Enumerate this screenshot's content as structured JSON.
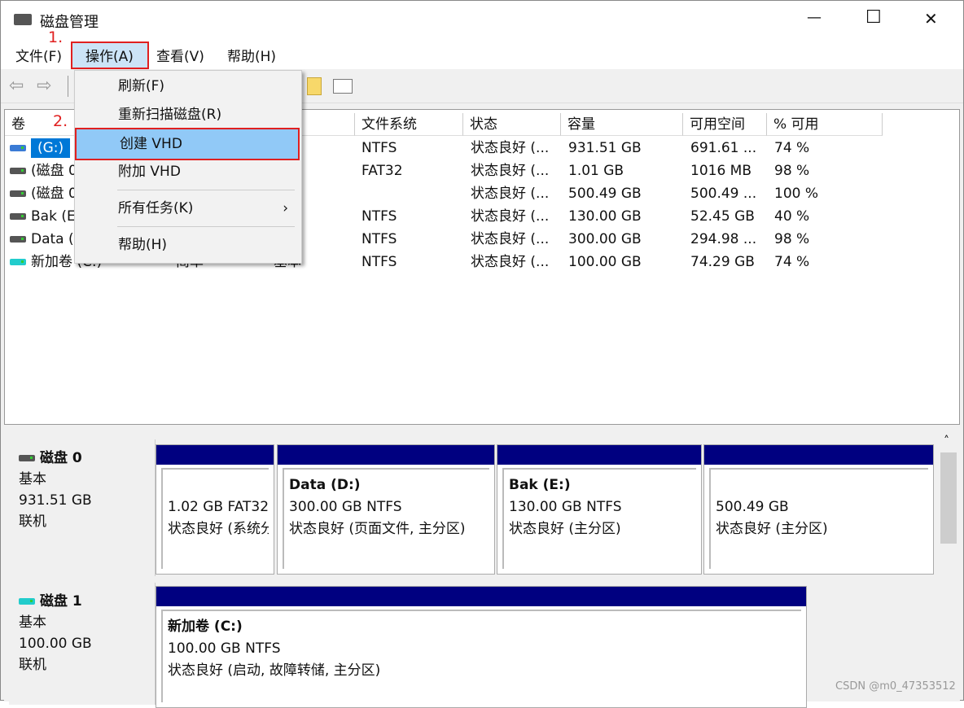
{
  "window": {
    "title": "磁盘管理",
    "minimize": "—",
    "maximize": "☐",
    "close": "✕"
  },
  "menubar": [
    {
      "label": "文件(F)"
    },
    {
      "label": "操作(A)"
    },
    {
      "label": "查看(V)"
    },
    {
      "label": "帮助(H)"
    }
  ],
  "annotations": {
    "step1": "1.",
    "step2": "2.",
    "accent": "#e02020"
  },
  "action_menu": {
    "items": [
      {
        "label": "刷新(F)"
      },
      {
        "label": "重新扫描磁盘(R)"
      },
      {
        "label": "创建 VHD",
        "highlighted": true
      },
      {
        "label": "附加 VHD"
      },
      {
        "label": "所有任务(K)",
        "submenu": "›"
      },
      {
        "label": "帮助(H)"
      }
    ]
  },
  "table": {
    "columns": [
      "卷",
      "",
      "",
      "文件系统",
      "状态",
      "容量",
      "可用空间",
      "% 可用"
    ],
    "rows": [
      {
        "vol": "(G:)",
        "layout": "",
        "type": "",
        "fs": "NTFS",
        "status": "状态良好 (...",
        "cap": "931.51 GB",
        "free": "691.61 ...",
        "pct": "74 %",
        "selected": true
      },
      {
        "vol": "(磁盘 0",
        "layout": "",
        "type": "",
        "fs": "FAT32",
        "status": "状态良好 (...",
        "cap": "1.01 GB",
        "free": "1016 MB",
        "pct": "98 %"
      },
      {
        "vol": "(磁盘 0",
        "layout": "",
        "type": "",
        "fs": "",
        "status": "状态良好 (...",
        "cap": "500.49 GB",
        "free": "500.49 ...",
        "pct": "100 %"
      },
      {
        "vol": "Bak (E:)",
        "layout": "",
        "type": "",
        "fs": "NTFS",
        "status": "状态良好 (...",
        "cap": "130.00 GB",
        "free": "52.45 GB",
        "pct": "40 %"
      },
      {
        "vol": "Data (D:)",
        "layout": "",
        "type": "",
        "fs": "NTFS",
        "status": "状态良好 (...",
        "cap": "300.00 GB",
        "free": "294.98 ...",
        "pct": "98 %"
      },
      {
        "vol": "新加卷 (C:)",
        "layout": "简单",
        "type": "基本",
        "fs": "NTFS",
        "status": "状态良好 (...",
        "cap": "100.00 GB",
        "free": "74.29 GB",
        "pct": "74 %"
      }
    ]
  },
  "disks": [
    {
      "name": "磁盘 0",
      "kind": "基本",
      "size": "931.51 GB",
      "state": "联机",
      "partitions": [
        {
          "title": "",
          "line1": "1.02 GB FAT32",
          "line2": "状态良好 (系统分区)"
        },
        {
          "title": "Data  (D:)",
          "line1": "300.00 GB NTFS",
          "line2": "状态良好 (页面文件, 主分区)"
        },
        {
          "title": "Bak  (E:)",
          "line1": "130.00 GB NTFS",
          "line2": "状态良好 (主分区)"
        },
        {
          "title": "",
          "line1": "500.49 GB",
          "line2": "状态良好 (主分区)"
        }
      ]
    },
    {
      "name": "磁盘 1",
      "kind": "基本",
      "size": "100.00 GB",
      "state": "联机",
      "partitions": [
        {
          "title": "新加卷  (C:)",
          "line1": "100.00 GB NTFS",
          "line2": "状态良好 (启动, 故障转储, 主分区)"
        }
      ]
    }
  ],
  "watermark": "CSDN @m0_47353512"
}
